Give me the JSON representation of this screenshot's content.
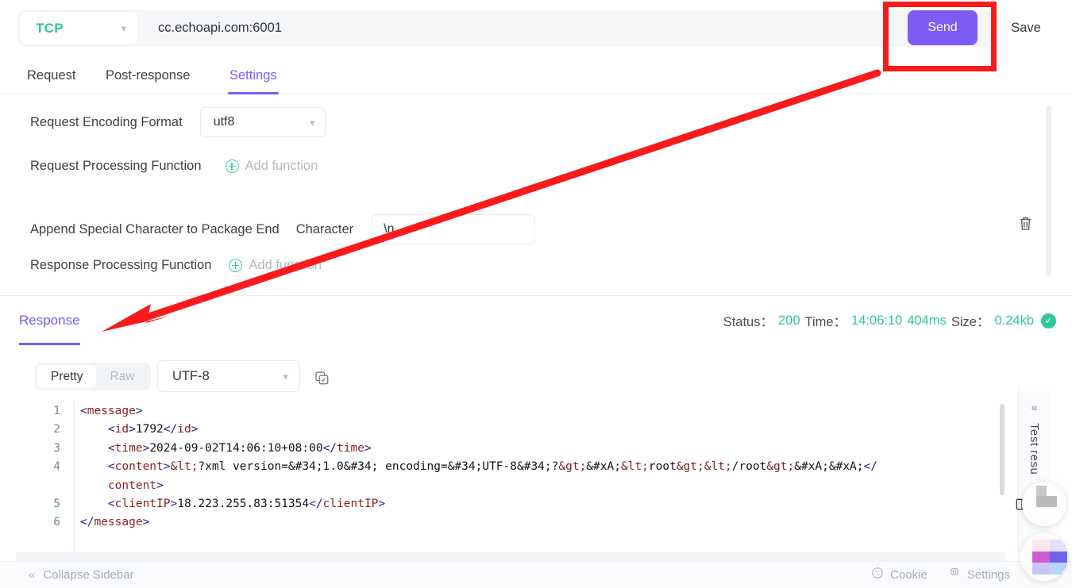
{
  "urlbar": {
    "protocol": "TCP",
    "protocol_chevron": "chevron-down-icon",
    "url": "cc.echoapi.com:6001",
    "send_label": "Send",
    "save_label": "Save",
    "accent_purple": "#7d5cf5",
    "protocol_color": "#27c79a"
  },
  "tabs": [
    {
      "label": "Request",
      "active": false
    },
    {
      "label": "Post-response",
      "active": false
    },
    {
      "label": "Settings",
      "active": true
    }
  ],
  "settings": {
    "encoding_label": "Request Encoding Format",
    "encoding_value": "utf8",
    "request_fn_label": "Request Processing Function",
    "request_fn_action": "Add function",
    "append_label": "Append Special Character to Package End",
    "character_label": "Character",
    "character_value": "\\n",
    "response_fn_label": "Response Processing Function",
    "response_fn_action": "Add function",
    "delete_icon": "trash-icon"
  },
  "response": {
    "tab_label": "Response",
    "status_key": "Status：",
    "status_value": "200",
    "time_key": "Time：",
    "time_value": "14:06:10",
    "duration_value": "404ms",
    "size_key": "Size：",
    "size_value": "0.24kb",
    "ok_icon": "check-circle-icon",
    "status_color": "#2ec99a"
  },
  "body_toolbar": {
    "pretty_label": "Pretty",
    "raw_label": "Raw",
    "active_view": "Pretty",
    "encoding_value": "UTF-8",
    "copy_icon": "copy-icon"
  },
  "code": {
    "language": "xml",
    "line_numbers": [
      "1",
      "2",
      "3",
      "4",
      "",
      "5",
      "6"
    ],
    "lines": [
      [
        {
          "t": "<",
          "c": "br"
        },
        {
          "t": "message",
          "c": "tg"
        },
        {
          "t": ">",
          "c": "br"
        }
      ],
      [
        {
          "t": "    <",
          "c": "br"
        },
        {
          "t": "id",
          "c": "tg"
        },
        {
          "t": ">",
          "c": "br"
        },
        {
          "t": "1792",
          "c": "tx"
        },
        {
          "t": "</",
          "c": "br"
        },
        {
          "t": "id",
          "c": "tg"
        },
        {
          "t": ">",
          "c": "br"
        }
      ],
      [
        {
          "t": "    <",
          "c": "br"
        },
        {
          "t": "time",
          "c": "tg"
        },
        {
          "t": ">",
          "c": "br"
        },
        {
          "t": "2024-09-02T14:06:10+08:00",
          "c": "tx"
        },
        {
          "t": "</",
          "c": "br"
        },
        {
          "t": "time",
          "c": "tg"
        },
        {
          "t": ">",
          "c": "br"
        }
      ],
      [
        {
          "t": "    <",
          "c": "br"
        },
        {
          "t": "content",
          "c": "tg"
        },
        {
          "t": ">",
          "c": "br"
        },
        {
          "t": "&lt;",
          "c": "tg"
        },
        {
          "t": "?xml version=&#34;1.0&#34; encoding=&#34;UTF-8&#34;?",
          "c": "tx"
        },
        {
          "t": "&gt;",
          "c": "tg"
        },
        {
          "t": "&#xA;",
          "c": "tx"
        },
        {
          "t": "&lt;",
          "c": "tg"
        },
        {
          "t": "root",
          "c": "tx"
        },
        {
          "t": "&gt;",
          "c": "tg"
        },
        {
          "t": "&lt;",
          "c": "tg"
        },
        {
          "t": "/root",
          "c": "tx"
        },
        {
          "t": "&gt;",
          "c": "tg"
        },
        {
          "t": "&#xA;&#xA;",
          "c": "tx"
        },
        {
          "t": "</",
          "c": "br"
        }
      ],
      [
        {
          "t": "    content",
          "c": "tg"
        },
        {
          "t": ">",
          "c": "br"
        }
      ],
      [
        {
          "t": "    <",
          "c": "br"
        },
        {
          "t": "clientIP",
          "c": "tg"
        },
        {
          "t": ">",
          "c": "br"
        },
        {
          "t": "18.223.255.83:51354",
          "c": "tx"
        },
        {
          "t": "</",
          "c": "br"
        },
        {
          "t": "clientIP",
          "c": "tg"
        },
        {
          "t": ">",
          "c": "br"
        }
      ],
      [
        {
          "t": "</",
          "c": "br"
        },
        {
          "t": "message",
          "c": "tg"
        },
        {
          "t": ">",
          "c": "br"
        }
      ]
    ]
  },
  "test_panel": {
    "label": "Test resu",
    "collapse_icon": "chevron-double-left-icon",
    "split_icon": "split-view-icon"
  },
  "bottombar": {
    "collapse_label": "Collapse Sidebar",
    "collapse_icon": "chevron-double-left-icon",
    "cookie_label": "Cookie",
    "cookie_icon": "cookie-icon",
    "settings_label": "Settings",
    "settings_icon": "gear-icon"
  },
  "annotations": {
    "highlight_color": "#f91b1b",
    "box_target": "Send",
    "arrow_target": "Response"
  }
}
